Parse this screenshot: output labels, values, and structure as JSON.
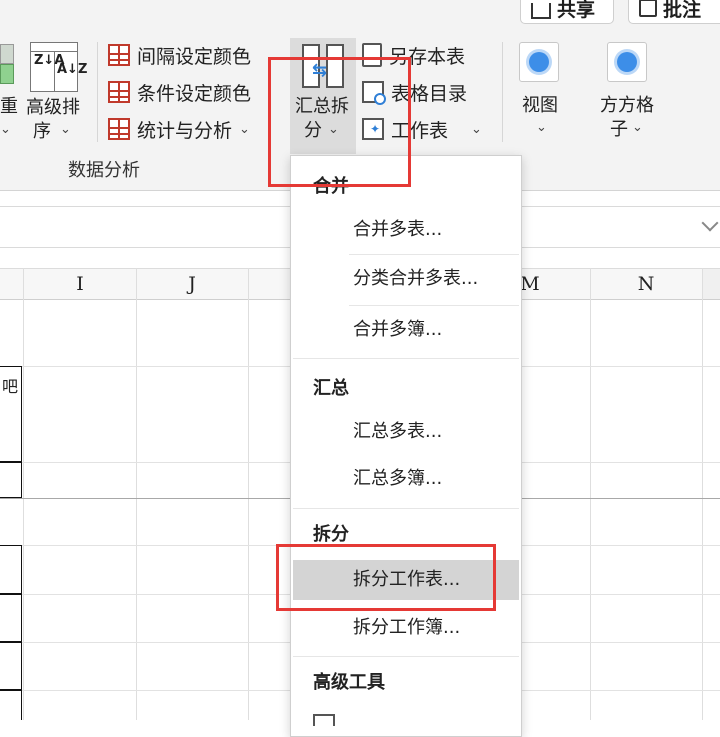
{
  "top_buttons": {
    "share": "共享",
    "comment": "批注"
  },
  "ribbon": {
    "partial_left_label": "重",
    "partial_left_chevron": "⌄",
    "sort": {
      "icon_top": "Z↓A",
      "icon_bottom": "A↓Z",
      "line1": "高级排",
      "line2": "序",
      "chevron": "⌄"
    },
    "analysis_buttons": [
      {
        "label": "间隔设定颜色"
      },
      {
        "label": "条件设定颜色"
      },
      {
        "label": "统计与分析",
        "chevron": "⌄"
      }
    ],
    "group_label": "数据分析",
    "merge_split": {
      "line1": "汇总拆",
      "line2": "分",
      "chevron": "⌄"
    },
    "save_as_sheet": "另存本表",
    "table_catalog": "表格目录",
    "worksheet": {
      "label": "工作表",
      "chevron": "⌄"
    },
    "view": {
      "label": "视图",
      "chevron": "⌄"
    },
    "fangfang": {
      "line1": "方方格",
      "line2": "子",
      "chevron": "⌄"
    }
  },
  "columns": [
    "I",
    "J",
    "M",
    "N"
  ],
  "partial_cell": "吧",
  "menu": {
    "sections": [
      {
        "header": "合并",
        "items": [
          "合并多表...",
          "分类合并多表...",
          "合并多簿..."
        ]
      },
      {
        "header": "汇总",
        "items": [
          "汇总多表...",
          "汇总多簿..."
        ]
      },
      {
        "header": "拆分",
        "items": [
          "拆分工作表...",
          "拆分工作簿..."
        ]
      },
      {
        "header": "高级工具",
        "items": []
      }
    ],
    "selected_item": "拆分工作表..."
  },
  "colors": {
    "highlight_box": "#e53935",
    "selected_item_bg": "#d4d4d4",
    "accent_blue": "#3d8ee8",
    "icon_red": "#c0392b"
  }
}
